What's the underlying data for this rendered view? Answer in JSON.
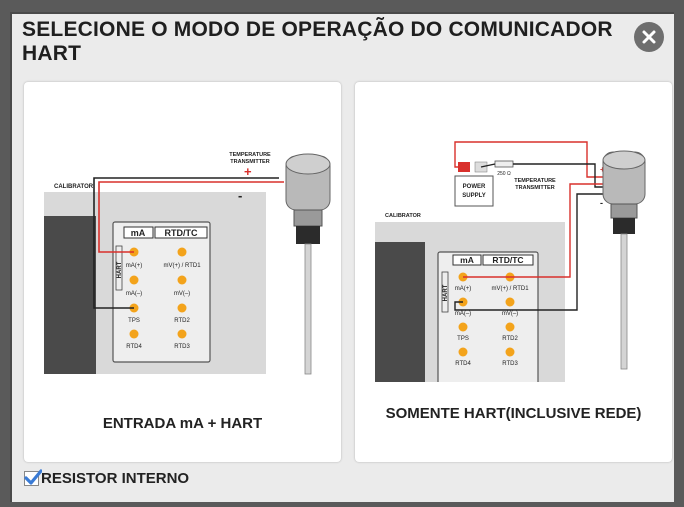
{
  "dialog": {
    "title": "SELECIONE O MODO DE OPERAÇÃO DO COMUNICADOR HART",
    "close_icon": "close-circle-icon"
  },
  "options": [
    {
      "label": "ENTRADA mA + HART",
      "diagram": {
        "calibrator": "CALIBRATOR",
        "transmitter": "TEMPERATURE\nTRANSMITTER",
        "plus": "+",
        "minus": "-",
        "hart": "HART",
        "col_ma": "mA",
        "col_rtd": "RTD/TC",
        "terminals_left": [
          "mA(+)",
          "mA(–)",
          "TPS",
          "RTD4"
        ],
        "terminals_right": [
          "mV(+) / RTD1",
          "mV(–)",
          "RTD2",
          "RTD3"
        ]
      }
    },
    {
      "label": "SOMENTE HART(INCLUSIVE REDE)",
      "diagram": {
        "calibrator": "CALIBRATOR",
        "transmitter": "TEMPERATURE\nTRANSMITTER",
        "power_supply": "POWER\nSUPPLY",
        "resistor": "250 Ω",
        "hart": "HART",
        "col_ma": "mA",
        "col_rtd": "RTD/TC",
        "terminals_left": [
          "mA(+)",
          "mA(–)",
          "TPS",
          "RTD4"
        ],
        "terminals_right": [
          "mV(+) / RTD1",
          "mV(–)",
          "RTD2",
          "RTD3"
        ]
      }
    }
  ],
  "checkbox": {
    "label": "RESISTOR INTERNO",
    "checked": true
  },
  "colors": {
    "wire_red": "#d9302c",
    "wire_black": "#222222",
    "terminal_orange": "#f3a31b",
    "check_blue": "#3a7bd5"
  }
}
